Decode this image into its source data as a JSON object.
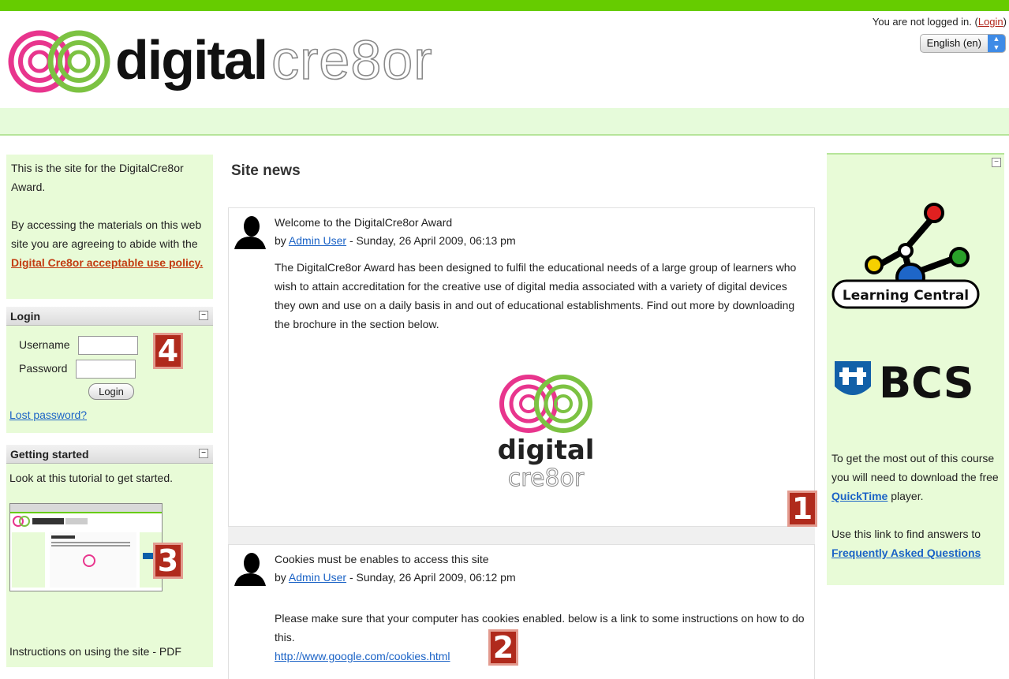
{
  "header": {
    "logo_text_bold": "digital",
    "logo_text_outline": "cre8or",
    "not_logged_in": "You are not logged in.",
    "login_link": "Login",
    "language": "English (en)"
  },
  "about": {
    "line1": "This is the site for the DigitalCre8or Award.",
    "line2_prefix": "By accessing the materials on this web site you are agreeing to abide with the",
    "policy_link": "Digital Cre8or acceptable use policy."
  },
  "login_block": {
    "title": "Login",
    "username_label": "Username",
    "password_label": "Password",
    "login_button": "Login",
    "lost_password": "Lost password?"
  },
  "getting_started": {
    "title": "Getting started",
    "text": "Look at this tutorial to get started.",
    "instructions": "Instructions on using the site - PDF"
  },
  "main": {
    "heading": "Site news",
    "posts": [
      {
        "title": "Welcome to the DigitalCre8or Award",
        "by": "by",
        "author": "Admin User",
        "date": " - Sunday, 26 April 2009, 06:13 pm",
        "body": "The DigitalCre8or Award has been designed to fulfil the educational needs of a large group of learners who wish to attain accreditation for the creative use of digital media associated with a variety of digital devices they own and use on a daily basis in and out of educational establishments. Find out more by downloading the brochure in the section below.",
        "image_text_1": "digital",
        "image_text_2": "cre8or"
      },
      {
        "title": "Cookies must be enables to access this site",
        "by": "by",
        "author": "Admin User",
        "date": " - Sunday, 26 April 2009, 06:12 pm",
        "body": "Please make sure that your computer has cookies enabled. below is a link to some instructions on how to do this.",
        "link": "http://www.google.com/cookies.html"
      }
    ]
  },
  "right": {
    "learning_central": "Learning Central",
    "bcs": "BCS",
    "text1": "To get the most out of this course you will need to download the free",
    "quicktime": "QuickTime",
    "text1_end": "player.",
    "text2": "Use this link to find answers to",
    "faq": "Frequently Asked Questions"
  },
  "badges": [
    "1",
    "2",
    "3",
    "4"
  ],
  "colors": {
    "topbar": "#66cc00",
    "block_bg": "#e8fbd7",
    "badge": "#b02a1c",
    "link": "#1b63c6"
  }
}
